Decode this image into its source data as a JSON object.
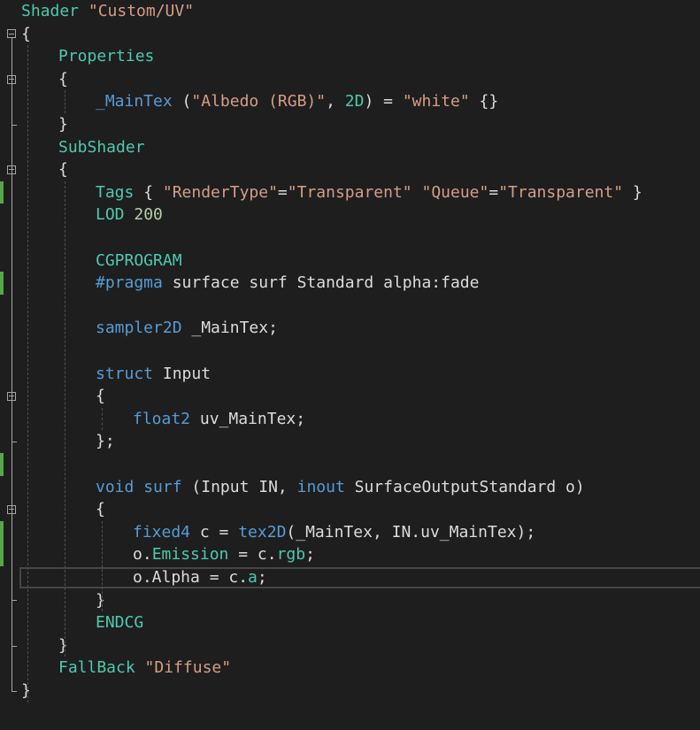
{
  "colors": {
    "background": "#1e1e1e",
    "default_text": "#dcdcdc",
    "keyword": "#569cd6",
    "type_keyword": "#4ec9b0",
    "string": "#d69d85",
    "number": "#b5cea8",
    "shaderlab_keyword": "#4ec9b0",
    "hlsl_keyword": "#569cd6",
    "change_marker": "#57a64a",
    "fold_glyph": "#a5a5a5"
  },
  "editor": {
    "lines": [
      {
        "indent": 0,
        "tokens": [
          {
            "t": "Shader ",
            "c": "#4ec9b0"
          },
          {
            "t": "\"Custom/UV\"",
            "c": "#d69d85"
          }
        ]
      },
      {
        "indent": 0,
        "fold": "open",
        "tokens": [
          {
            "t": "{",
            "c": "#dcdcdc"
          }
        ]
      },
      {
        "indent": 1,
        "tokens": [
          {
            "t": "Properties",
            "c": "#4ec9b0"
          }
        ]
      },
      {
        "indent": 1,
        "fold": "open",
        "tokens": [
          {
            "t": "{",
            "c": "#dcdcdc"
          }
        ]
      },
      {
        "indent": 2,
        "tokens": [
          {
            "t": "_MainTex",
            "c": "#569cd6"
          },
          {
            "t": " (",
            "c": "#dcdcdc"
          },
          {
            "t": "\"Albedo (RGB)\"",
            "c": "#d69d85"
          },
          {
            "t": ", ",
            "c": "#dcdcdc"
          },
          {
            "t": "2D",
            "c": "#4ec9b0"
          },
          {
            "t": ") = ",
            "c": "#dcdcdc"
          },
          {
            "t": "\"white\"",
            "c": "#d69d85"
          },
          {
            "t": " {}",
            "c": "#dcdcdc"
          }
        ]
      },
      {
        "indent": 1,
        "tokens": [
          {
            "t": "}",
            "c": "#dcdcdc"
          }
        ]
      },
      {
        "indent": 1,
        "tokens": [
          {
            "t": "SubShader",
            "c": "#4ec9b0"
          }
        ]
      },
      {
        "indent": 1,
        "fold": "open",
        "tokens": [
          {
            "t": "{",
            "c": "#dcdcdc"
          }
        ]
      },
      {
        "indent": 2,
        "changed": true,
        "tokens": [
          {
            "t": "Tags",
            "c": "#4ec9b0"
          },
          {
            "t": " { ",
            "c": "#dcdcdc"
          },
          {
            "t": "\"RenderType\"",
            "c": "#d69d85"
          },
          {
            "t": "=",
            "c": "#dcdcdc"
          },
          {
            "t": "\"Transparent\"",
            "c": "#d69d85"
          },
          {
            "t": " ",
            "c": "#dcdcdc"
          },
          {
            "t": "\"Queue\"",
            "c": "#d69d85"
          },
          {
            "t": "=",
            "c": "#dcdcdc"
          },
          {
            "t": "\"Transparent\"",
            "c": "#d69d85"
          },
          {
            "t": " }",
            "c": "#dcdcdc"
          }
        ]
      },
      {
        "indent": 2,
        "tokens": [
          {
            "t": "LOD",
            "c": "#4ec9b0"
          },
          {
            "t": " 200",
            "c": "#b5cea8"
          }
        ]
      },
      {
        "indent": 0,
        "tokens": []
      },
      {
        "indent": 2,
        "tokens": [
          {
            "t": "CGPROGRAM",
            "c": "#4ec9b0"
          }
        ]
      },
      {
        "indent": 2,
        "changed": true,
        "tokens": [
          {
            "t": "#pragma",
            "c": "#569cd6"
          },
          {
            "t": " surface surf Standard alpha:fade",
            "c": "#dcdcdc"
          }
        ]
      },
      {
        "indent": 0,
        "tokens": []
      },
      {
        "indent": 2,
        "tokens": [
          {
            "t": "sampler2D",
            "c": "#569cd6"
          },
          {
            "t": " _MainTex;",
            "c": "#dcdcdc"
          }
        ]
      },
      {
        "indent": 0,
        "tokens": []
      },
      {
        "indent": 2,
        "tokens": [
          {
            "t": "struct",
            "c": "#569cd6"
          },
          {
            "t": " Input",
            "c": "#dcdcdc"
          }
        ]
      },
      {
        "indent": 2,
        "fold": "open",
        "tokens": [
          {
            "t": "{",
            "c": "#dcdcdc"
          }
        ]
      },
      {
        "indent": 3,
        "tokens": [
          {
            "t": "float2",
            "c": "#569cd6"
          },
          {
            "t": " uv_MainTex;",
            "c": "#dcdcdc"
          }
        ]
      },
      {
        "indent": 2,
        "tokens": [
          {
            "t": "};",
            "c": "#dcdcdc"
          }
        ]
      },
      {
        "indent": 0,
        "changed": true,
        "tokens": []
      },
      {
        "indent": 2,
        "tokens": [
          {
            "t": "void",
            "c": "#569cd6"
          },
          {
            "t": " ",
            "c": "#dcdcdc"
          },
          {
            "t": "surf",
            "c": "#569cd6"
          },
          {
            "t": " (Input IN, ",
            "c": "#dcdcdc"
          },
          {
            "t": "inout",
            "c": "#569cd6"
          },
          {
            "t": " SurfaceOutputStandard o)",
            "c": "#dcdcdc"
          }
        ]
      },
      {
        "indent": 2,
        "fold": "open",
        "tokens": [
          {
            "t": "{",
            "c": "#dcdcdc"
          }
        ]
      },
      {
        "indent": 3,
        "changed": true,
        "tokens": [
          {
            "t": "fixed4",
            "c": "#569cd6"
          },
          {
            "t": " c = ",
            "c": "#dcdcdc"
          },
          {
            "t": "tex2D",
            "c": "#569cd6"
          },
          {
            "t": "(_MainTex, IN.uv_MainTex);",
            "c": "#dcdcdc"
          }
        ]
      },
      {
        "indent": 3,
        "changed": true,
        "tokens": [
          {
            "t": "o.",
            "c": "#dcdcdc"
          },
          {
            "t": "Emission",
            "c": "#4ec9b0"
          },
          {
            "t": " = c.",
            "c": "#dcdcdc"
          },
          {
            "t": "rgb",
            "c": "#4ec9b0"
          },
          {
            "t": ";",
            "c": "#dcdcdc"
          }
        ]
      },
      {
        "indent": 3,
        "current": true,
        "tokens": [
          {
            "t": "o.Alpha = c.",
            "c": "#dcdcdc"
          },
          {
            "t": "a",
            "c": "#4ec9b0"
          },
          {
            "t": ";",
            "c": "#dcdcdc"
          }
        ]
      },
      {
        "indent": 2,
        "tokens": [
          {
            "t": "}",
            "c": "#dcdcdc"
          }
        ]
      },
      {
        "indent": 2,
        "tokens": [
          {
            "t": "ENDCG",
            "c": "#4ec9b0"
          }
        ]
      },
      {
        "indent": 1,
        "tokens": [
          {
            "t": "}",
            "c": "#dcdcdc"
          }
        ]
      },
      {
        "indent": 1,
        "tokens": [
          {
            "t": "FallBack",
            "c": "#4ec9b0"
          },
          {
            "t": " ",
            "c": "#dcdcdc"
          },
          {
            "t": "\"Diffuse\"",
            "c": "#d69d85"
          }
        ]
      },
      {
        "indent": 0,
        "tokens": [
          {
            "t": "}",
            "c": "#dcdcdc"
          }
        ]
      }
    ]
  }
}
